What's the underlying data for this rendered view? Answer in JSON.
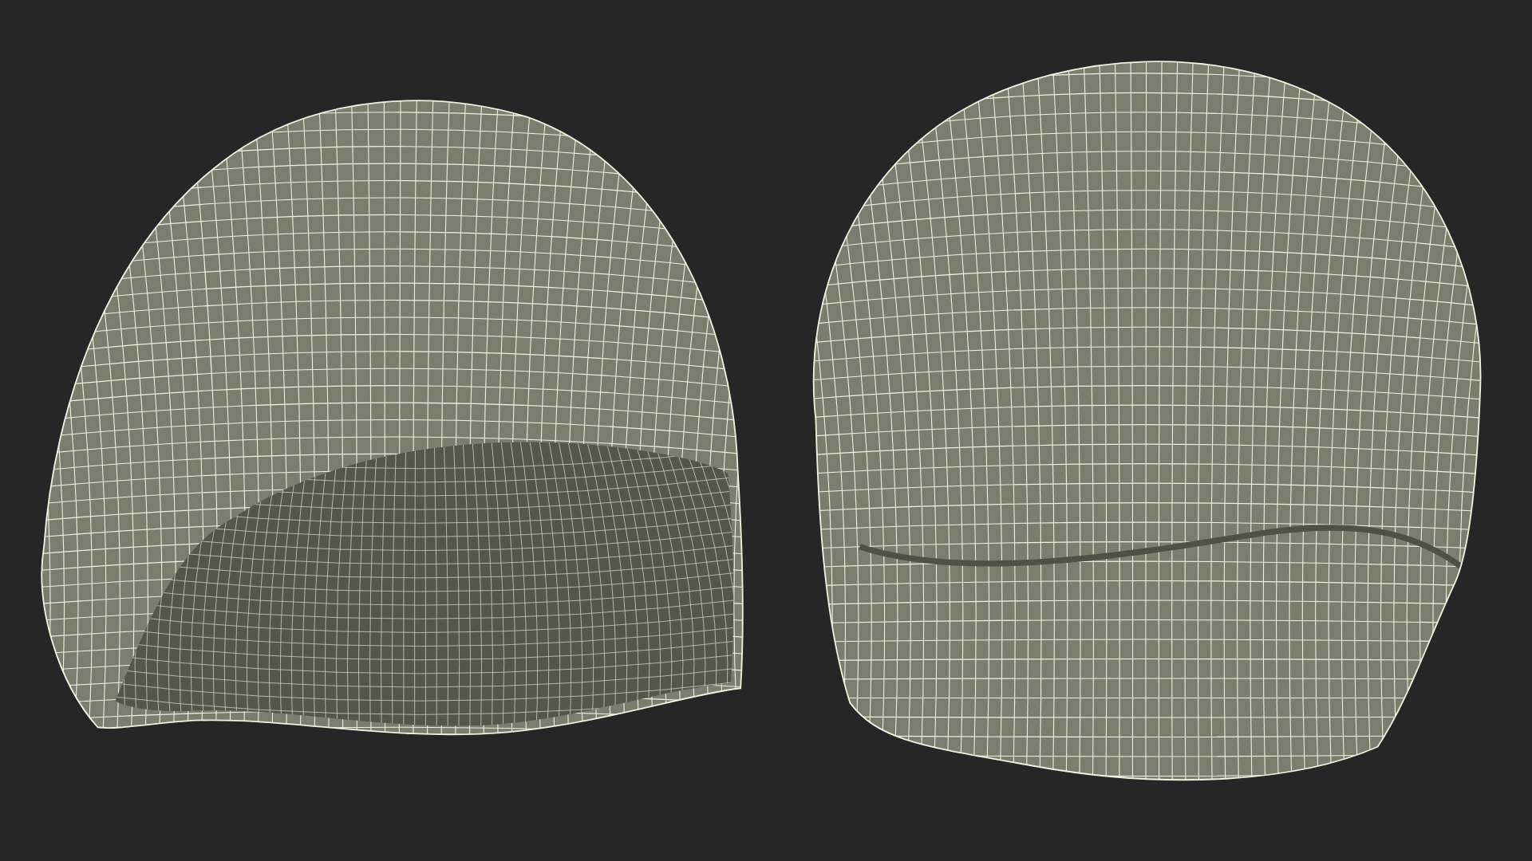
{
  "models": [
    {
      "kind": "inside"
    },
    {
      "kind": "outside"
    }
  ]
}
